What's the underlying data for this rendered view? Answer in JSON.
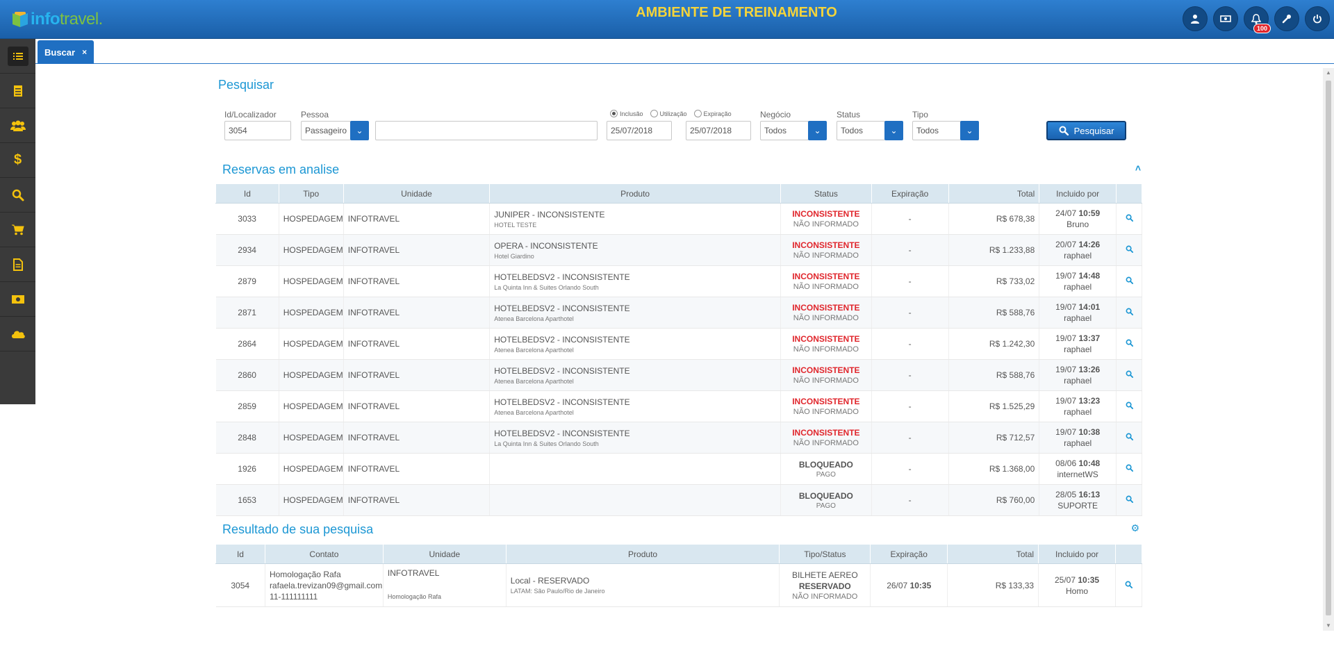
{
  "header": {
    "logo_info": "info",
    "logo_travel": "travel.",
    "title": "AMBIENTE DE TREINAMENTO",
    "notifications_badge": "100",
    "icons": [
      "user-icon",
      "money-icon",
      "bell-icon",
      "wrench-icon",
      "power-icon"
    ]
  },
  "sidebar": {
    "items": [
      "menu-list-icon",
      "receipt-icon",
      "users-icon",
      "dollar-icon",
      "search-icon",
      "cart-icon",
      "document-icon",
      "cash-icon",
      "cloud-icon"
    ]
  },
  "tab": {
    "label": "Buscar",
    "close": "×"
  },
  "search": {
    "title": "Pesquisar",
    "id_label": "Id/Localizador",
    "id_value": "3054",
    "pessoa_label": "Pessoa",
    "pessoa_value": "Passageiro",
    "text_value": "",
    "radios": [
      "Inclusão",
      "Utilização",
      "Expiração"
    ],
    "radio_selected": "Inclusão",
    "date_from": "25/07/2018",
    "date_to": "25/07/2018",
    "negocio_label": "Negócio",
    "negocio_value": "Todos",
    "status_label": "Status",
    "status_value": "Todos",
    "tipo_label": "Tipo",
    "tipo_value": "Todos",
    "button": "Pesquisar"
  },
  "reservas": {
    "title": "Reservas em analise",
    "columns": [
      "Id",
      "Tipo",
      "Unidade",
      "Produto",
      "Status",
      "Expiração",
      "Total",
      "Incluido por"
    ],
    "rows": [
      {
        "id": "3033",
        "tipo": "HOSPEDAGEM",
        "unidade": "INFOTRAVEL",
        "produto": "JUNIPER - INCONSISTENTE",
        "produto_sub": "HOTEL TESTE",
        "status": "INCONSISTENTE",
        "status_sub": "NÃO INFORMADO",
        "exp": "-",
        "total": "R$  678,38",
        "inc_date": "24/07",
        "inc_time": "10:59",
        "inc_user": "Bruno"
      },
      {
        "id": "2934",
        "tipo": "HOSPEDAGEM",
        "unidade": "INFOTRAVEL",
        "produto": "OPERA - INCONSISTENTE",
        "produto_sub": "Hotel Giardino",
        "status": "INCONSISTENTE",
        "status_sub": "NÃO INFORMADO",
        "exp": "-",
        "total": "R$  1.233,88",
        "inc_date": "20/07",
        "inc_time": "14:26",
        "inc_user": "raphael"
      },
      {
        "id": "2879",
        "tipo": "HOSPEDAGEM",
        "unidade": "INFOTRAVEL",
        "produto": "HOTELBEDSV2 - INCONSISTENTE",
        "produto_sub": "La Quinta Inn & Suites Orlando South",
        "status": "INCONSISTENTE",
        "status_sub": "NÃO INFORMADO",
        "exp": "-",
        "total": "R$  733,02",
        "inc_date": "19/07",
        "inc_time": "14:48",
        "inc_user": "raphael"
      },
      {
        "id": "2871",
        "tipo": "HOSPEDAGEM",
        "unidade": "INFOTRAVEL",
        "produto": "HOTELBEDSV2 - INCONSISTENTE",
        "produto_sub": "Atenea Barcelona Aparthotel",
        "status": "INCONSISTENTE",
        "status_sub": "NÃO INFORMADO",
        "exp": "-",
        "total": "R$  588,76",
        "inc_date": "19/07",
        "inc_time": "14:01",
        "inc_user": "raphael"
      },
      {
        "id": "2864",
        "tipo": "HOSPEDAGEM",
        "unidade": "INFOTRAVEL",
        "produto": "HOTELBEDSV2 - INCONSISTENTE",
        "produto_sub": "Atenea Barcelona Aparthotel",
        "status": "INCONSISTENTE",
        "status_sub": "NÃO INFORMADO",
        "exp": "-",
        "total": "R$  1.242,30",
        "inc_date": "19/07",
        "inc_time": "13:37",
        "inc_user": "raphael"
      },
      {
        "id": "2860",
        "tipo": "HOSPEDAGEM",
        "unidade": "INFOTRAVEL",
        "produto": "HOTELBEDSV2 - INCONSISTENTE",
        "produto_sub": "Atenea Barcelona Aparthotel",
        "status": "INCONSISTENTE",
        "status_sub": "NÃO INFORMADO",
        "exp": "-",
        "total": "R$  588,76",
        "inc_date": "19/07",
        "inc_time": "13:26",
        "inc_user": "raphael"
      },
      {
        "id": "2859",
        "tipo": "HOSPEDAGEM",
        "unidade": "INFOTRAVEL",
        "produto": "HOTELBEDSV2 - INCONSISTENTE",
        "produto_sub": "Atenea Barcelona Aparthotel",
        "status": "INCONSISTENTE",
        "status_sub": "NÃO INFORMADO",
        "exp": "-",
        "total": "R$  1.525,29",
        "inc_date": "19/07",
        "inc_time": "13:23",
        "inc_user": "raphael"
      },
      {
        "id": "2848",
        "tipo": "HOSPEDAGEM",
        "unidade": "INFOTRAVEL",
        "produto": "HOTELBEDSV2 - INCONSISTENTE",
        "produto_sub": "La Quinta Inn & Suites Orlando South",
        "status": "INCONSISTENTE",
        "status_sub": "NÃO INFORMADO",
        "exp": "-",
        "total": "R$  712,57",
        "inc_date": "19/07",
        "inc_time": "10:38",
        "inc_user": "raphael"
      },
      {
        "id": "1926",
        "tipo": "HOSPEDAGEM",
        "unidade": "INFOTRAVEL",
        "produto": "",
        "produto_sub": "",
        "status": "BLOQUEADO",
        "status_sub": "PAGO",
        "exp": "-",
        "total": "R$  1.368,00",
        "inc_date": "08/06",
        "inc_time": "10:48",
        "inc_user": "internetWS"
      },
      {
        "id": "1653",
        "tipo": "HOSPEDAGEM",
        "unidade": "INFOTRAVEL",
        "produto": "",
        "produto_sub": "",
        "status": "BLOQUEADO",
        "status_sub": "PAGO",
        "exp": "-",
        "total": "R$  760,00",
        "inc_date": "28/05",
        "inc_time": "16:13",
        "inc_user": "SUPORTE"
      }
    ]
  },
  "resultado": {
    "title": "Resultado de sua pesquisa",
    "columns": [
      "Id",
      "Contato",
      "Unidade",
      "Produto",
      "Tipo/Status",
      "Expiração",
      "Total",
      "Incluido por"
    ],
    "row": {
      "id": "3054",
      "contato_nome": "Homologação Rafa",
      "contato_email": "rafaela.trevizan09@gmail.com",
      "contato_fone": "11-111111111",
      "unidade": "INFOTRAVEL",
      "unidade_sub": "Homologação Rafa",
      "produto": "Local - RESERVADO",
      "produto_sub": "LATAM: São Paulo/Rio de Janeiro",
      "tipo": "BILHETE AEREO",
      "tipo_status": "RESERVADO",
      "tipo_sub": "NÃO INFORMADO",
      "exp_date": "26/07",
      "exp_time": "10:35",
      "total": "R$  133,33",
      "inc_date": "25/07",
      "inc_time": "10:35",
      "inc_user": "Homo"
    }
  }
}
